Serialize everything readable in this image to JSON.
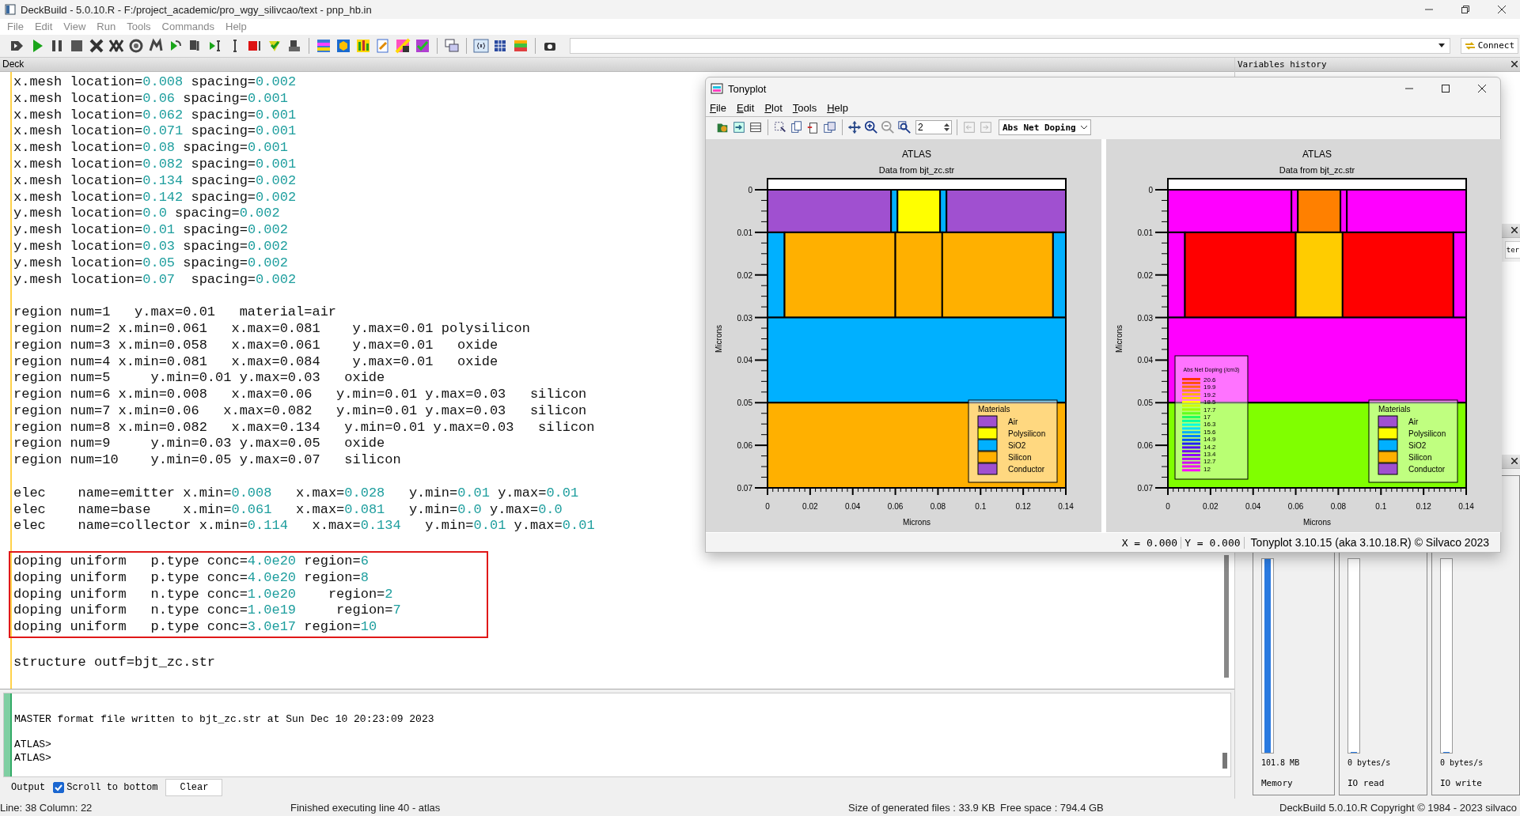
{
  "window": {
    "title": "DeckBuild - 5.0.10.R - F:/project_academic/pro_wgy_silivcao/text - pnp_hb.in"
  },
  "menu": [
    "File",
    "Edit",
    "View",
    "Run",
    "Tools",
    "Commands",
    "Help"
  ],
  "toolbar": {
    "connect": "Connect"
  },
  "deck": {
    "title": "Deck",
    "blocks": [
      {
        "boxed": false,
        "lines": [
          [
            "x.mesh location=",
            "0.008",
            " spacing=",
            "0.002"
          ],
          [
            "x.mesh location=",
            "0.06",
            " spacing=",
            "0.001"
          ],
          [
            "x.mesh location=",
            "0.062",
            " spacing=",
            "0.001"
          ],
          [
            "x.mesh location=",
            "0.071",
            " spacing=",
            "0.001"
          ],
          [
            "x.mesh location=",
            "0.08",
            " spacing=",
            "0.001"
          ],
          [
            "x.mesh location=",
            "0.082",
            " spacing=",
            "0.001"
          ],
          [
            "x.mesh location=",
            "0.134",
            " spacing=",
            "0.002"
          ],
          [
            "x.mesh location=",
            "0.142",
            " spacing=",
            "0.002"
          ],
          [
            "y.mesh location=",
            "0.0",
            " spacing=",
            "0.002"
          ],
          [
            "y.mesh location=",
            "0.01",
            " spacing=",
            "0.002"
          ],
          [
            "y.mesh location=",
            "0.03",
            " spacing=",
            "0.002"
          ],
          [
            "y.mesh location=",
            "0.05",
            " spacing=",
            "0.002"
          ],
          [
            "y.mesh location=",
            "0.07",
            "  spacing=",
            "0.002"
          ]
        ]
      },
      {
        "boxed": false,
        "lines": [
          [
            "region num=1   y.max=0.01   material=air"
          ],
          [
            "region num=2 x.min=0.061   x.max=0.081    y.max=0.01 polysilicon"
          ],
          [
            "region num=3 x.min=0.058   x.max=0.061    y.max=0.01   oxide"
          ],
          [
            "region num=4 x.min=0.081   x.max=0.084    y.max=0.01   oxide"
          ],
          [
            "region num=5     y.min=0.01 y.max=0.03   oxide"
          ],
          [
            "region num=6 x.min=0.008   x.max=0.06   y.min=0.01 y.max=0.03   silicon"
          ],
          [
            "region num=7 x.min=0.06   x.max=0.082   y.min=0.01 y.max=0.03   silicon"
          ],
          [
            "region num=8 x.min=0.082   x.max=0.134   y.min=0.01 y.max=0.03   silicon"
          ],
          [
            "region num=9     y.min=0.03 y.max=0.05   oxide"
          ],
          [
            "region num=10    y.min=0.05 y.max=0.07   silicon"
          ]
        ]
      },
      {
        "boxed": false,
        "lines": [
          [
            "elec    name=emitter x.min=",
            "0.008",
            "   x.max=",
            "0.028",
            "   y.min=",
            "0.01",
            " y.max=",
            "0.01"
          ],
          [
            "elec    name=base    x.min=",
            "0.061",
            "   x.max=",
            "0.081",
            "   y.min=",
            "0.0",
            " y.max=",
            "0.0"
          ],
          [
            "elec    name=collector x.min=",
            "0.114",
            "   x.max=",
            "0.134",
            "   y.min=",
            "0.01",
            " y.max=",
            "0.01"
          ]
        ]
      },
      {
        "boxed": true,
        "lines": [
          [
            "doping uniform   p.type conc=",
            "4.0e20",
            " region=",
            "6"
          ],
          [
            "doping uniform   p.type conc=",
            "4.0e20",
            " region=",
            "8"
          ],
          [
            "doping uniform   n.type conc=",
            "1.0e20",
            "    region=",
            "2"
          ],
          [
            "doping uniform   n.type conc=",
            "1.0e19",
            "     region=",
            "7"
          ],
          [
            "doping uniform   p.type conc=",
            "3.0e17",
            " region=",
            "10"
          ]
        ]
      },
      {
        "boxed": false,
        "lines": [
          [
            "structure outf=bjt_zc.str"
          ]
        ]
      }
    ]
  },
  "variables_panel": {
    "title": "Variables history"
  },
  "side_button": "ter",
  "meters": [
    {
      "reading": "101.8 MB",
      "label": "Memory",
      "level": 1
    },
    {
      "reading": "0 bytes/s",
      "label": "IO read",
      "level": 0
    },
    {
      "reading": "0 bytes/s",
      "label": "IO write",
      "level": 0
    }
  ],
  "output": {
    "lines": [
      "MASTER format file written to bjt_zc.str at Sun Dec 10 20:23:09 2023",
      "ATLAS>",
      "ATLAS>"
    ],
    "label": "Output",
    "scroll_to_bottom": {
      "label": "Scroll to bottom",
      "checked": true
    },
    "clear": "Clear"
  },
  "status_bar": {
    "position": "Line: 38 Column: 22",
    "message": "Finished executing line 40 - atlas",
    "size": "Size of generated files : 33.9 KB",
    "free": "Free space : 794.4 GB",
    "copyright": "DeckBuild 5.0.10.R  Copyright © 1984 - 2023 silvaco"
  },
  "tonyplot": {
    "title": "Tonyplot",
    "menu": [
      "File",
      "Edit",
      "Plot",
      "Tools",
      "Help"
    ],
    "zoom_value": "2",
    "quantity": "Abs Net Doping",
    "plots": [
      {
        "title": "ATLAS",
        "subtitle": "Data from bjt_zc.str",
        "xlabel": "Microns",
        "ylabel": "Microns",
        "kind": "materials",
        "xticks": [
          "0",
          "0.02",
          "0.04",
          "0.06",
          "0.08",
          "0.1",
          "0.12",
          "0.14"
        ],
        "yticks": [
          "0",
          "0.01",
          "0.02",
          "0.03",
          "0.04",
          "0.05",
          "0.06",
          "0.07"
        ],
        "legend": {
          "title": "Materials",
          "items": [
            {
              "label": "Air",
              "color": "#a050d0"
            },
            {
              "label": "Polysilicon",
              "color": "#ffff00"
            },
            {
              "label": "SiO2",
              "color": "#00b0ff"
            },
            {
              "label": "Silicon",
              "color": "#ffb000"
            },
            {
              "label": "Conductor",
              "color": "#a050d0"
            }
          ]
        }
      },
      {
        "title": "ATLAS",
        "subtitle": "Data from bjt_zc.str",
        "xlabel": "Microns",
        "ylabel": "Microns",
        "kind": "doping",
        "xticks": [
          "0",
          "0.02",
          "0.04",
          "0.06",
          "0.08",
          "0.1",
          "0.12",
          "0.14"
        ],
        "yticks": [
          "0",
          "0.01",
          "0.02",
          "0.03",
          "0.04",
          "0.05",
          "0.06",
          "0.07"
        ],
        "legend": {
          "title": "Materials",
          "items": [
            {
              "label": "Air",
              "color": "#a050d0"
            },
            {
              "label": "Polysilicon",
              "color": "#ffff00"
            },
            {
              "label": "SiO2",
              "color": "#00b0ff"
            },
            {
              "label": "Silicon",
              "color": "#ffb000"
            },
            {
              "label": "Conductor",
              "color": "#a050d0"
            }
          ]
        },
        "doping_legend": {
          "title": "Abs Net Doping (/cm3)",
          "labels": [
            "20.6",
            "19.9",
            "19.2",
            "18.5",
            "17.7",
            "17",
            "16.3",
            "15.6",
            "14.9",
            "14.2",
            "13.4",
            "12.7",
            "12"
          ]
        }
      }
    ],
    "x_readout": "X = 0.000",
    "y_readout": "Y = 0.000",
    "version": "Tonyplot 3.10.15 (aka 3.10.18.R) © Silvaco 2023"
  }
}
